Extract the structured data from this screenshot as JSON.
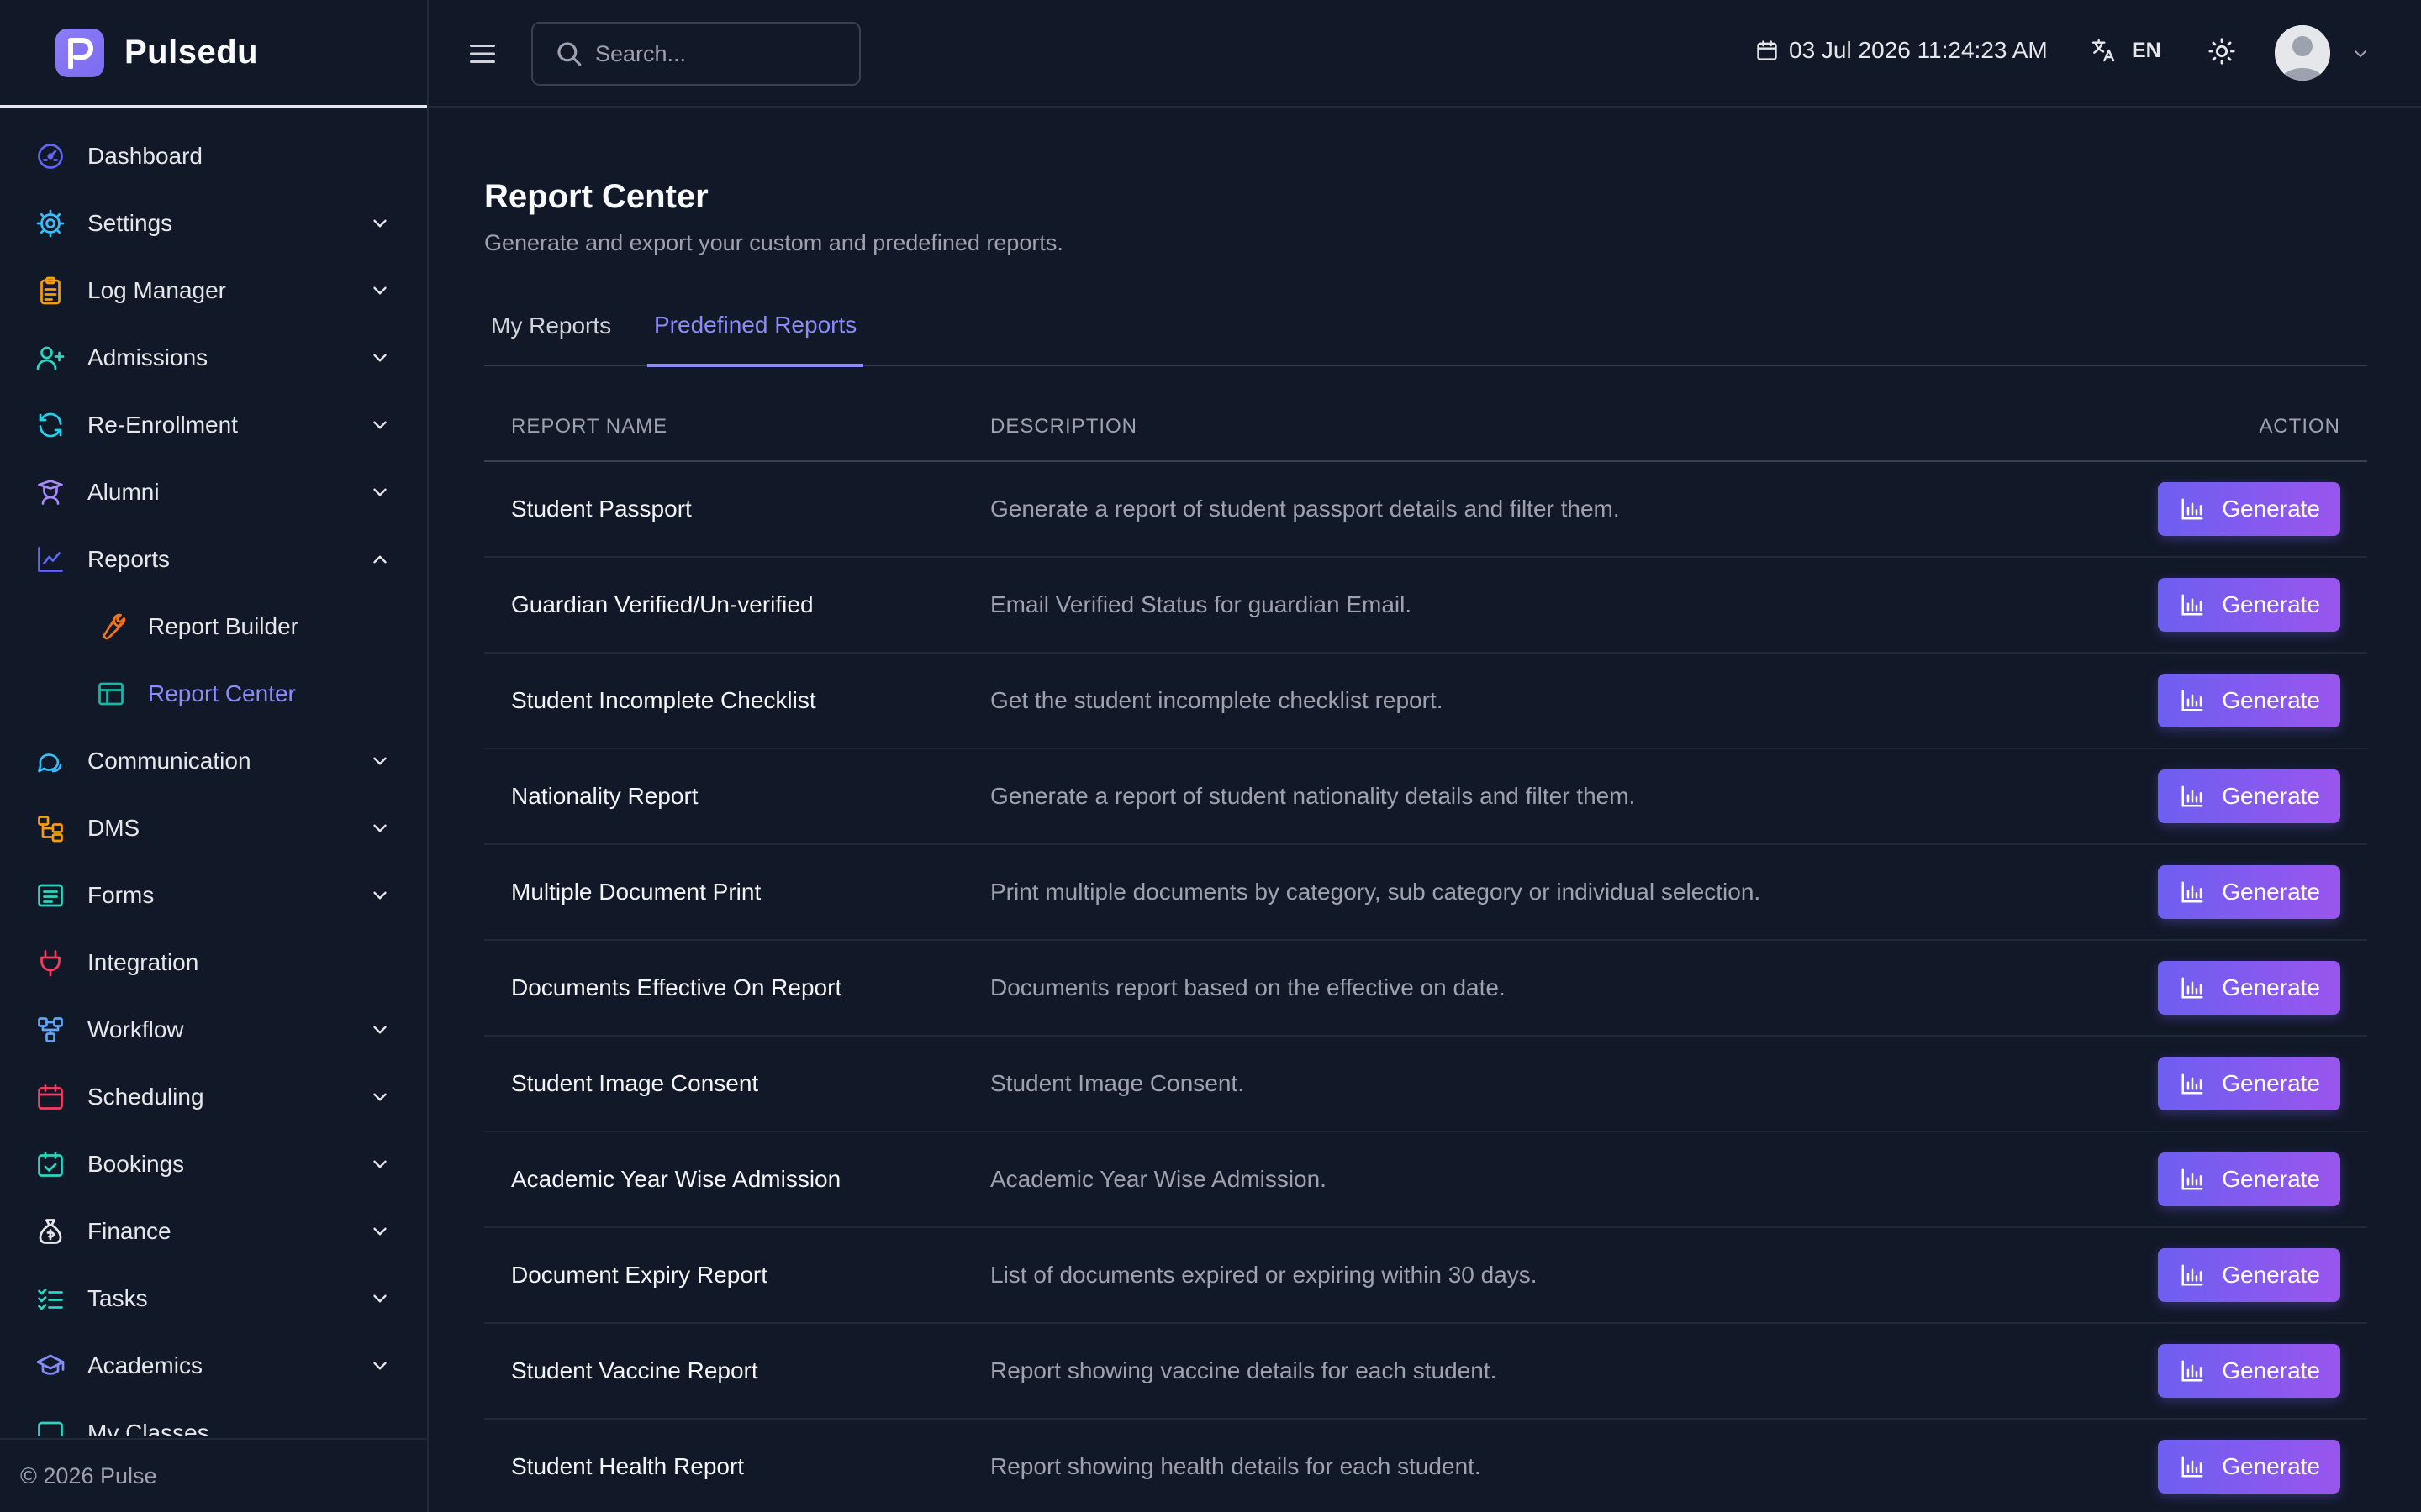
{
  "brand": {
    "name": "Pulsedu"
  },
  "sidebar": {
    "items": [
      {
        "label": "Dashboard",
        "icon": "dashboard-icon",
        "color": "#6366f1",
        "expandable": false
      },
      {
        "label": "Settings",
        "icon": "gear-icon",
        "color": "#38bdf8",
        "expandable": true
      },
      {
        "label": "Log Manager",
        "icon": "clipboard-icon",
        "color": "#f59e0b",
        "expandable": true
      },
      {
        "label": "Admissions",
        "icon": "user-plus-icon",
        "color": "#2dd4bf",
        "expandable": true
      },
      {
        "label": "Re-Enrollment",
        "icon": "refresh-icon",
        "color": "#22d3ee",
        "expandable": true
      },
      {
        "label": "Alumni",
        "icon": "graduate-icon",
        "color": "#a78bfa",
        "expandable": true
      },
      {
        "label": "Reports",
        "icon": "chart-line-icon",
        "color": "#6366f1",
        "expandable": true,
        "expanded": true
      },
      {
        "label": "Report Builder",
        "icon": "wrench-icon",
        "color": "#f97316",
        "sub": true
      },
      {
        "label": "Report Center",
        "icon": "table-icon",
        "color": "#14b8a6",
        "sub": true,
        "active": true
      },
      {
        "label": "Communication",
        "icon": "chat-icon",
        "color": "#38bdf8",
        "expandable": true
      },
      {
        "label": "DMS",
        "icon": "folder-tree-icon",
        "color": "#f59e0b",
        "expandable": true
      },
      {
        "label": "Forms",
        "icon": "form-icon",
        "color": "#2dd4bf",
        "expandable": true
      },
      {
        "label": "Integration",
        "icon": "plug-icon",
        "color": "#f43f5e",
        "expandable": false
      },
      {
        "label": "Workflow",
        "icon": "workflow-icon",
        "color": "#60a5fa",
        "expandable": true
      },
      {
        "label": "Scheduling",
        "icon": "calendar-icon",
        "color": "#f43f5e",
        "expandable": true
      },
      {
        "label": "Bookings",
        "icon": "calendar-check-icon",
        "color": "#2dd4bf",
        "expandable": true
      },
      {
        "label": "Finance",
        "icon": "money-bag-icon",
        "color": "#e5e7eb",
        "expandable": true
      },
      {
        "label": "Tasks",
        "icon": "checklist-icon",
        "color": "#2dd4bf",
        "expandable": true
      },
      {
        "label": "Academics",
        "icon": "graduation-cap-icon",
        "color": "#818cf8",
        "expandable": true
      },
      {
        "label": "My Classes",
        "icon": "classes-icon",
        "color": "#2dd4bf",
        "expandable": false
      }
    ],
    "footer": "© 2026 Pulse"
  },
  "topbar": {
    "search_placeholder": "Search...",
    "datetime": "03 Jul 2026 11:24:23 AM",
    "language": "EN"
  },
  "page": {
    "title": "Report Center",
    "subtitle": "Generate and export your custom and predefined reports.",
    "tabs": [
      {
        "label": "My Reports",
        "active": false
      },
      {
        "label": "Predefined Reports",
        "active": true
      }
    ]
  },
  "table": {
    "headers": {
      "name": "REPORT NAME",
      "description": "DESCRIPTION",
      "action": "ACTION"
    },
    "button_label": "Generate",
    "rows": [
      {
        "name": "Student Passport",
        "description": "Generate a report of student passport details and filter them."
      },
      {
        "name": "Guardian Verified/Un-verified",
        "description": "Email Verified Status for guardian Email."
      },
      {
        "name": "Student Incomplete Checklist",
        "description": "Get the student incomplete checklist report."
      },
      {
        "name": "Nationality Report",
        "description": "Generate a report of student nationality details and filter them."
      },
      {
        "name": "Multiple Document Print",
        "description": "Print multiple documents by category, sub category or individual selection."
      },
      {
        "name": "Documents Effective On Report",
        "description": "Documents report based on the effective on date."
      },
      {
        "name": "Student Image Consent",
        "description": "Student Image Consent."
      },
      {
        "name": "Academic Year Wise Admission",
        "description": "Academic Year Wise Admission."
      },
      {
        "name": "Document Expiry Report",
        "description": "List of documents expired or expiring within 30 days."
      },
      {
        "name": "Student Vaccine Report",
        "description": "Report showing vaccine details for each student."
      },
      {
        "name": "Student Health Report",
        "description": "Report showing health details for each student."
      }
    ]
  },
  "colors": {
    "background": "#111827",
    "accent": "#8b8cf8",
    "button_gradient_start": "#6d5ff0",
    "button_gradient_end": "#9a55ee"
  }
}
